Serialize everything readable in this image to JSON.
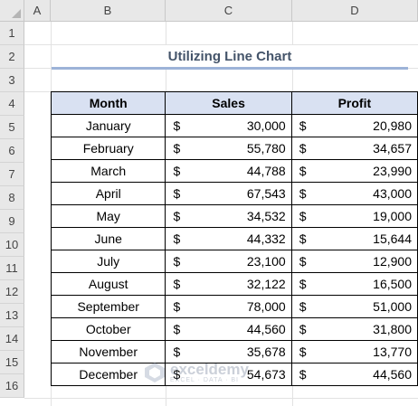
{
  "columns": [
    "A",
    "B",
    "C",
    "D"
  ],
  "rows": [
    "1",
    "2",
    "3",
    "4",
    "5",
    "6",
    "7",
    "8",
    "9",
    "10",
    "11",
    "12",
    "13",
    "14",
    "15",
    "16"
  ],
  "title": "Utilizing Line Chart",
  "table": {
    "headers": [
      "Month",
      "Sales",
      "Profit"
    ],
    "currency": "$",
    "rows": [
      {
        "month": "January",
        "sales": "30,000",
        "profit": "20,980"
      },
      {
        "month": "February",
        "sales": "55,780",
        "profit": "34,657"
      },
      {
        "month": "March",
        "sales": "44,788",
        "profit": "23,990"
      },
      {
        "month": "April",
        "sales": "67,543",
        "profit": "43,000"
      },
      {
        "month": "May",
        "sales": "34,532",
        "profit": "19,000"
      },
      {
        "month": "June",
        "sales": "44,332",
        "profit": "15,644"
      },
      {
        "month": "July",
        "sales": "23,100",
        "profit": "12,900"
      },
      {
        "month": "August",
        "sales": "32,122",
        "profit": "16,500"
      },
      {
        "month": "September",
        "sales": "78,000",
        "profit": "51,000"
      },
      {
        "month": "October",
        "sales": "44,560",
        "profit": "31,800"
      },
      {
        "month": "November",
        "sales": "35,678",
        "profit": "13,770"
      },
      {
        "month": "December",
        "sales": "54,673",
        "profit": "44,560"
      }
    ]
  },
  "watermark": {
    "name": "exceldemy",
    "tagline": "EXCEL · DATA · BI"
  }
}
